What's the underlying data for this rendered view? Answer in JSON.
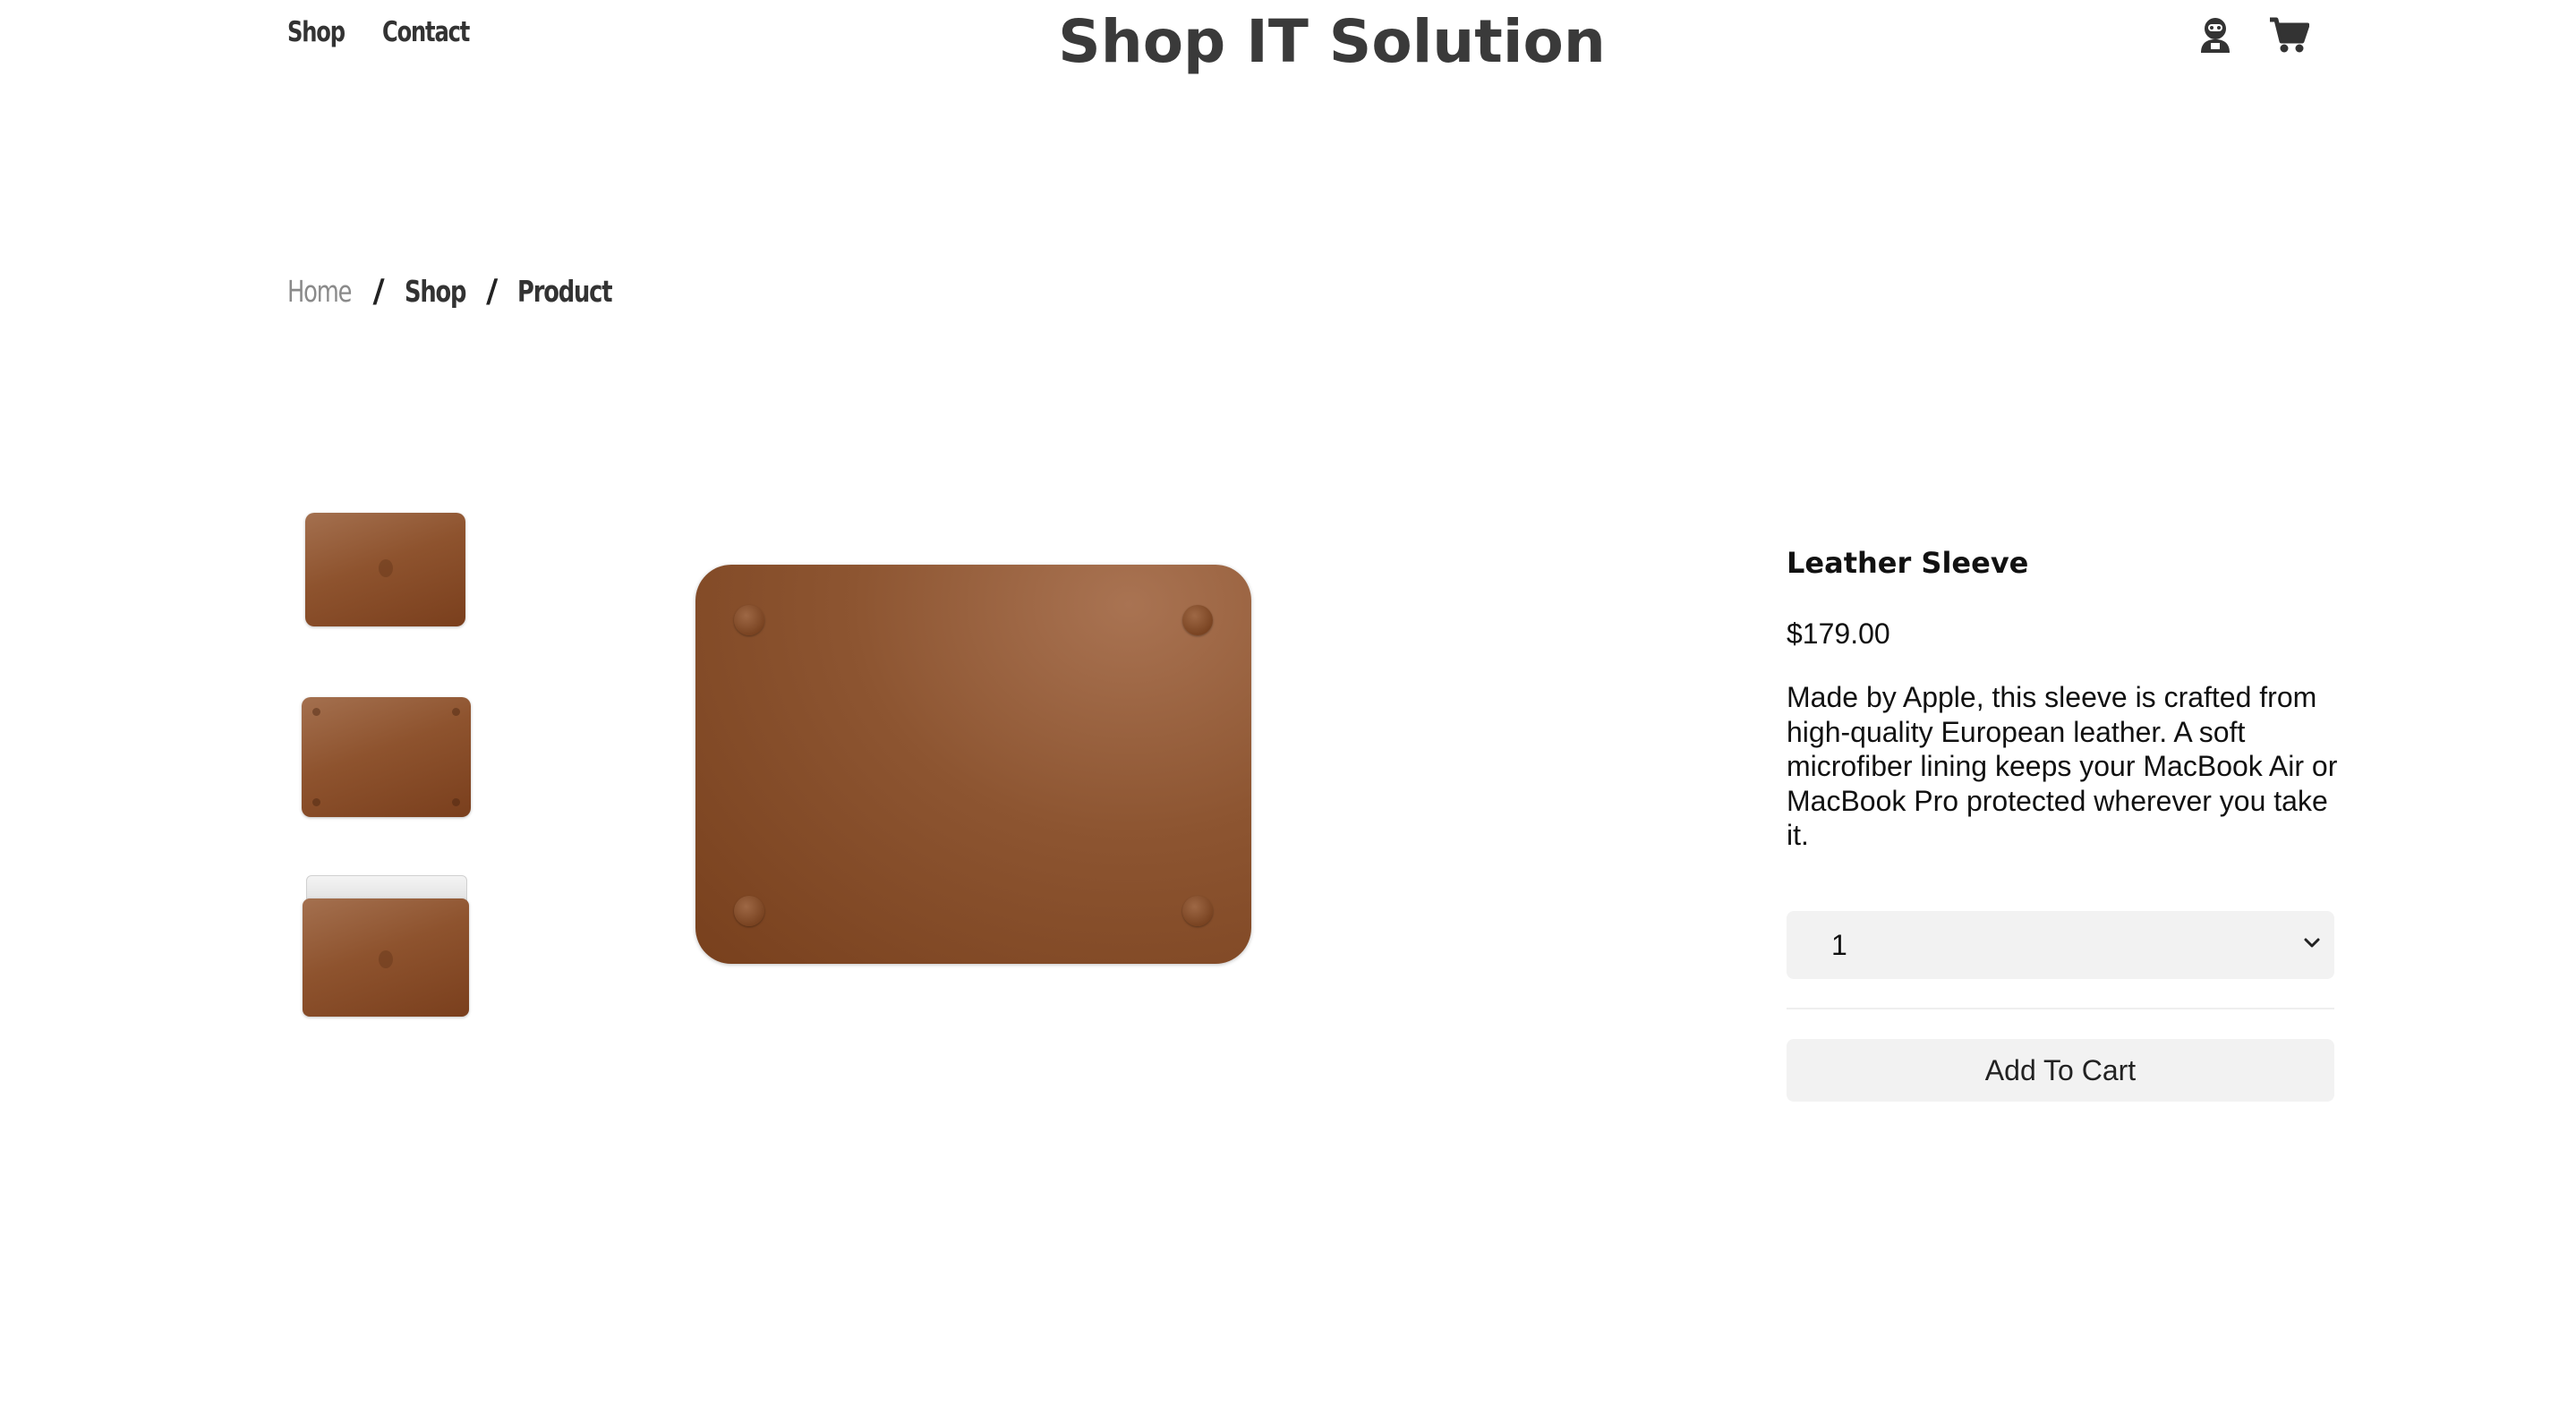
{
  "header": {
    "nav": [
      "Shop",
      "Contact"
    ],
    "brand": "Shop IT Solution",
    "icons": [
      "user-icon",
      "cart-icon"
    ]
  },
  "breadcrumb": {
    "items": [
      "Home",
      "Shop",
      "Product"
    ],
    "separator": "/"
  },
  "gallery": {
    "thumbnails": [
      "leather-sleeve-top-thumbnail",
      "leather-sleeve-bottom-thumbnail",
      "leather-sleeve-with-laptop-thumbnail"
    ],
    "main_image": "leather-sleeve-bottom-view"
  },
  "product": {
    "name": "Leather Sleeve",
    "price": "$179.00",
    "description": "Made by Apple, this sleeve is crafted from high-quality European leather. A soft microfiber lining keeps your MacBook Air or MacBook Pro protected wherever you take it.",
    "quantity": "1",
    "add_to_cart_label": "Add To Cart"
  },
  "colors": {
    "leather": "#8d5531",
    "text": "#111111",
    "control_bg": "#f2f2f2"
  }
}
